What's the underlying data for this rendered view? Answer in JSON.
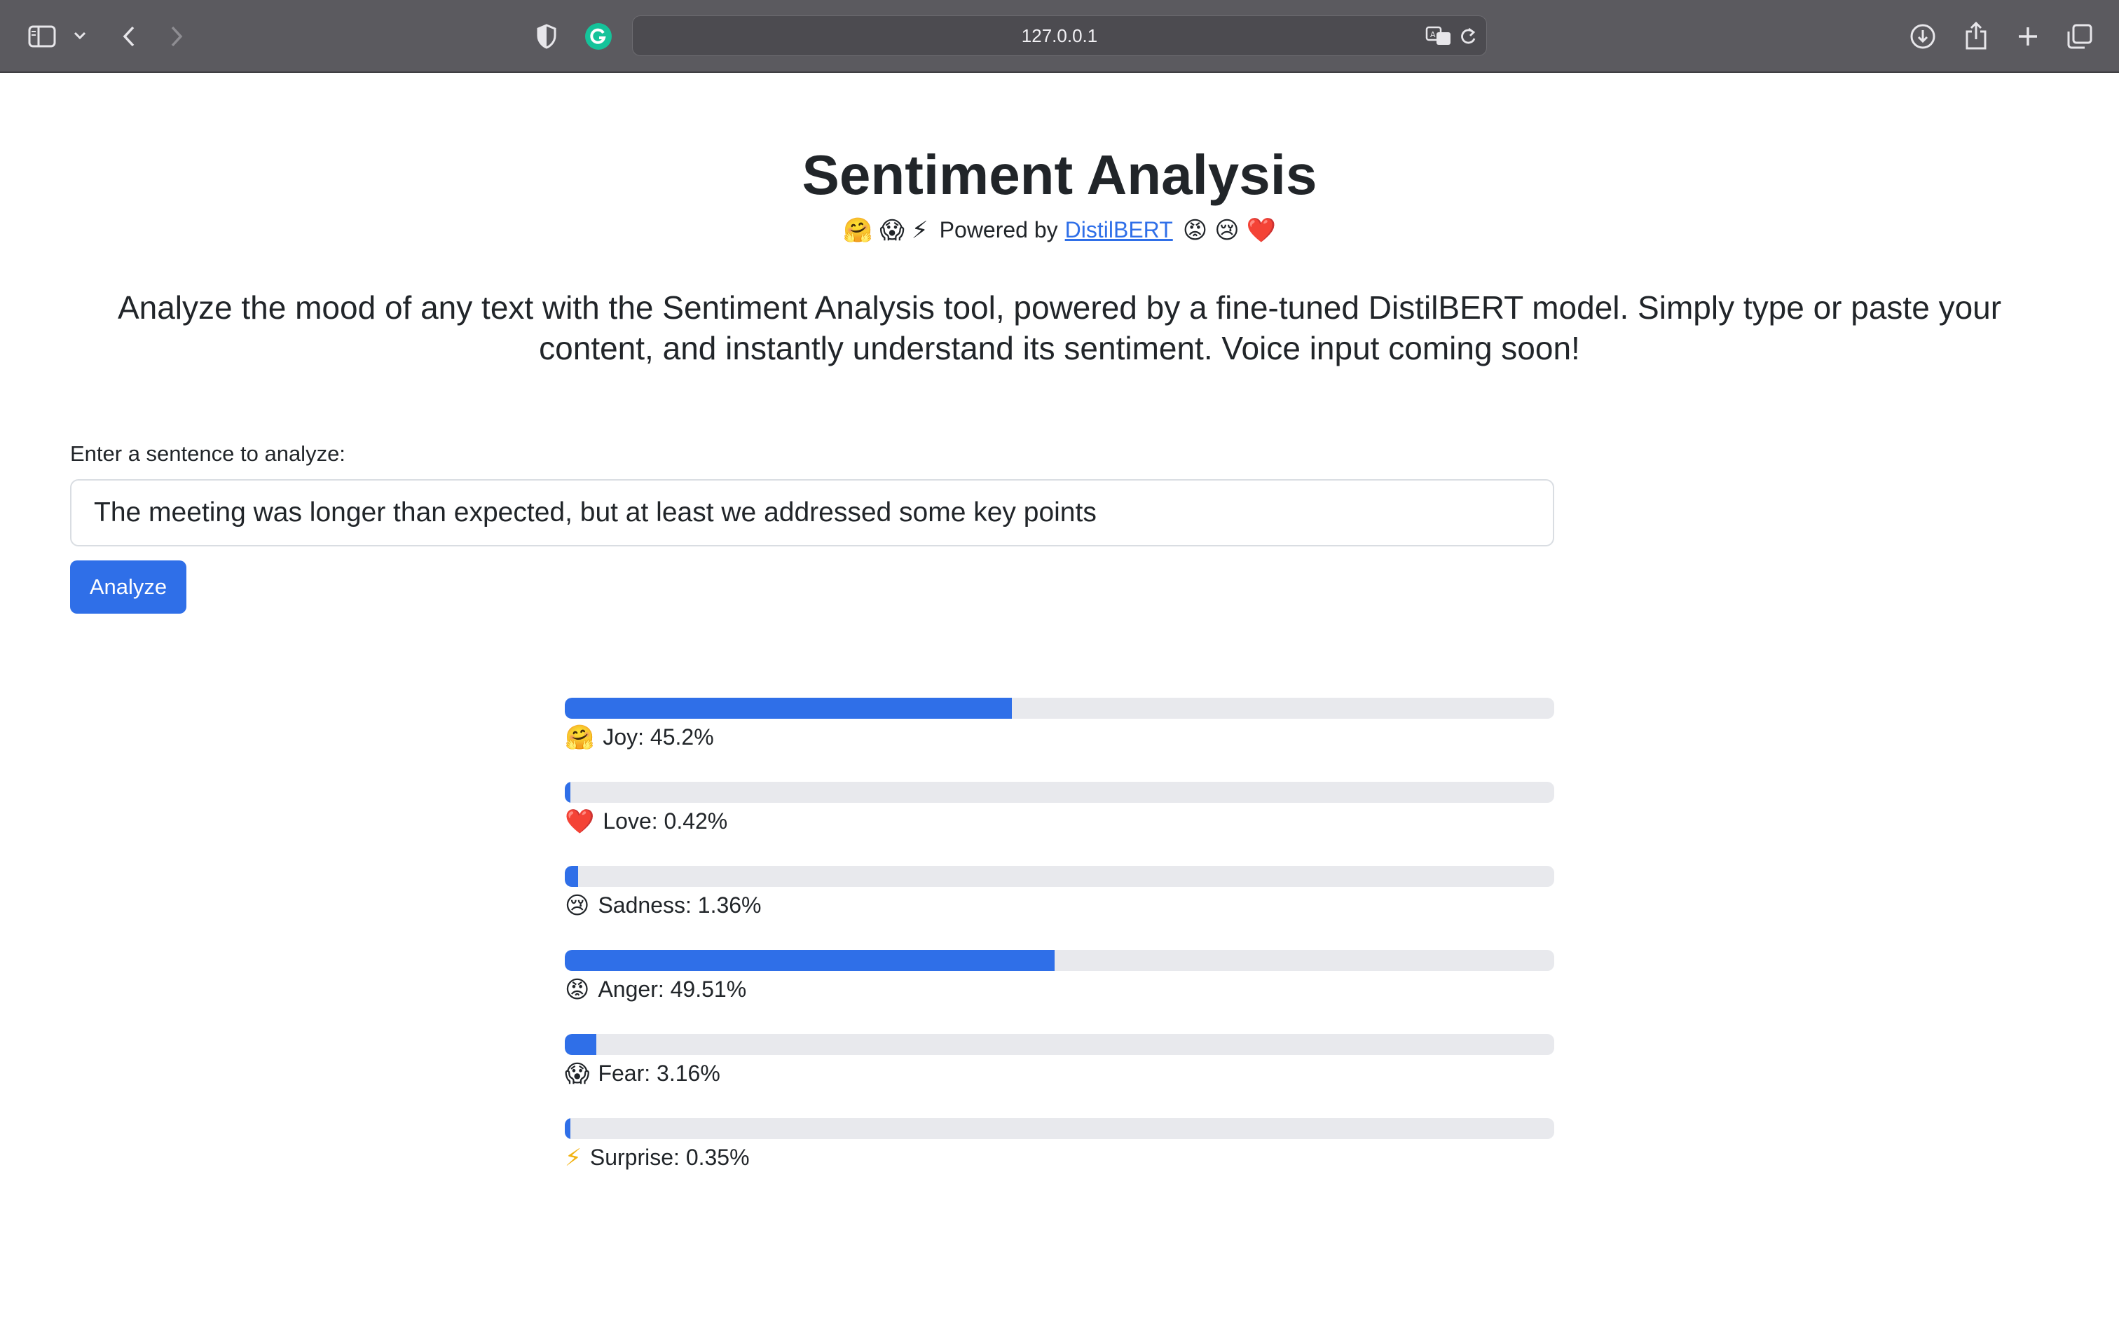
{
  "browser": {
    "url": "127.0.0.1"
  },
  "page": {
    "title": "Sentiment Analysis",
    "powered_prefix": "Powered by",
    "powered_link": "DistilBERT",
    "emojis_left": [
      "🤗",
      "😱",
      "⚡"
    ],
    "emojis_right": [
      "😡",
      "😢",
      "❤️"
    ],
    "intro": "Analyze the mood of any text with the Sentiment Analysis tool, powered by a fine-tuned DistilBERT model. Simply type or paste your content, and instantly understand its sentiment. Voice input coming soon!",
    "input_label": "Enter a sentence to analyze:",
    "input_value": "The meeting was longer than expected, but at least we addressed some key points",
    "analyze_label": "Analyze"
  },
  "results": [
    {
      "emoji": "🤗",
      "label": "Joy: 45.2%",
      "value": 45.2
    },
    {
      "emoji": "❤️",
      "label": "Love: 0.42%",
      "value": 0.42
    },
    {
      "emoji": "😢",
      "label": "Sadness: 1.36%",
      "value": 1.36
    },
    {
      "emoji": "😡",
      "label": "Anger: 49.51%",
      "value": 49.51
    },
    {
      "emoji": "😱",
      "label": "Fear: 3.16%",
      "value": 3.16
    },
    {
      "emoji": "⚡",
      "label": "Surprise: 0.35%",
      "value": 0.35
    }
  ],
  "colors": {
    "accent": "#2f6fe8",
    "track": "#e8e9ed",
    "toolbar": "#5b5a5f"
  }
}
